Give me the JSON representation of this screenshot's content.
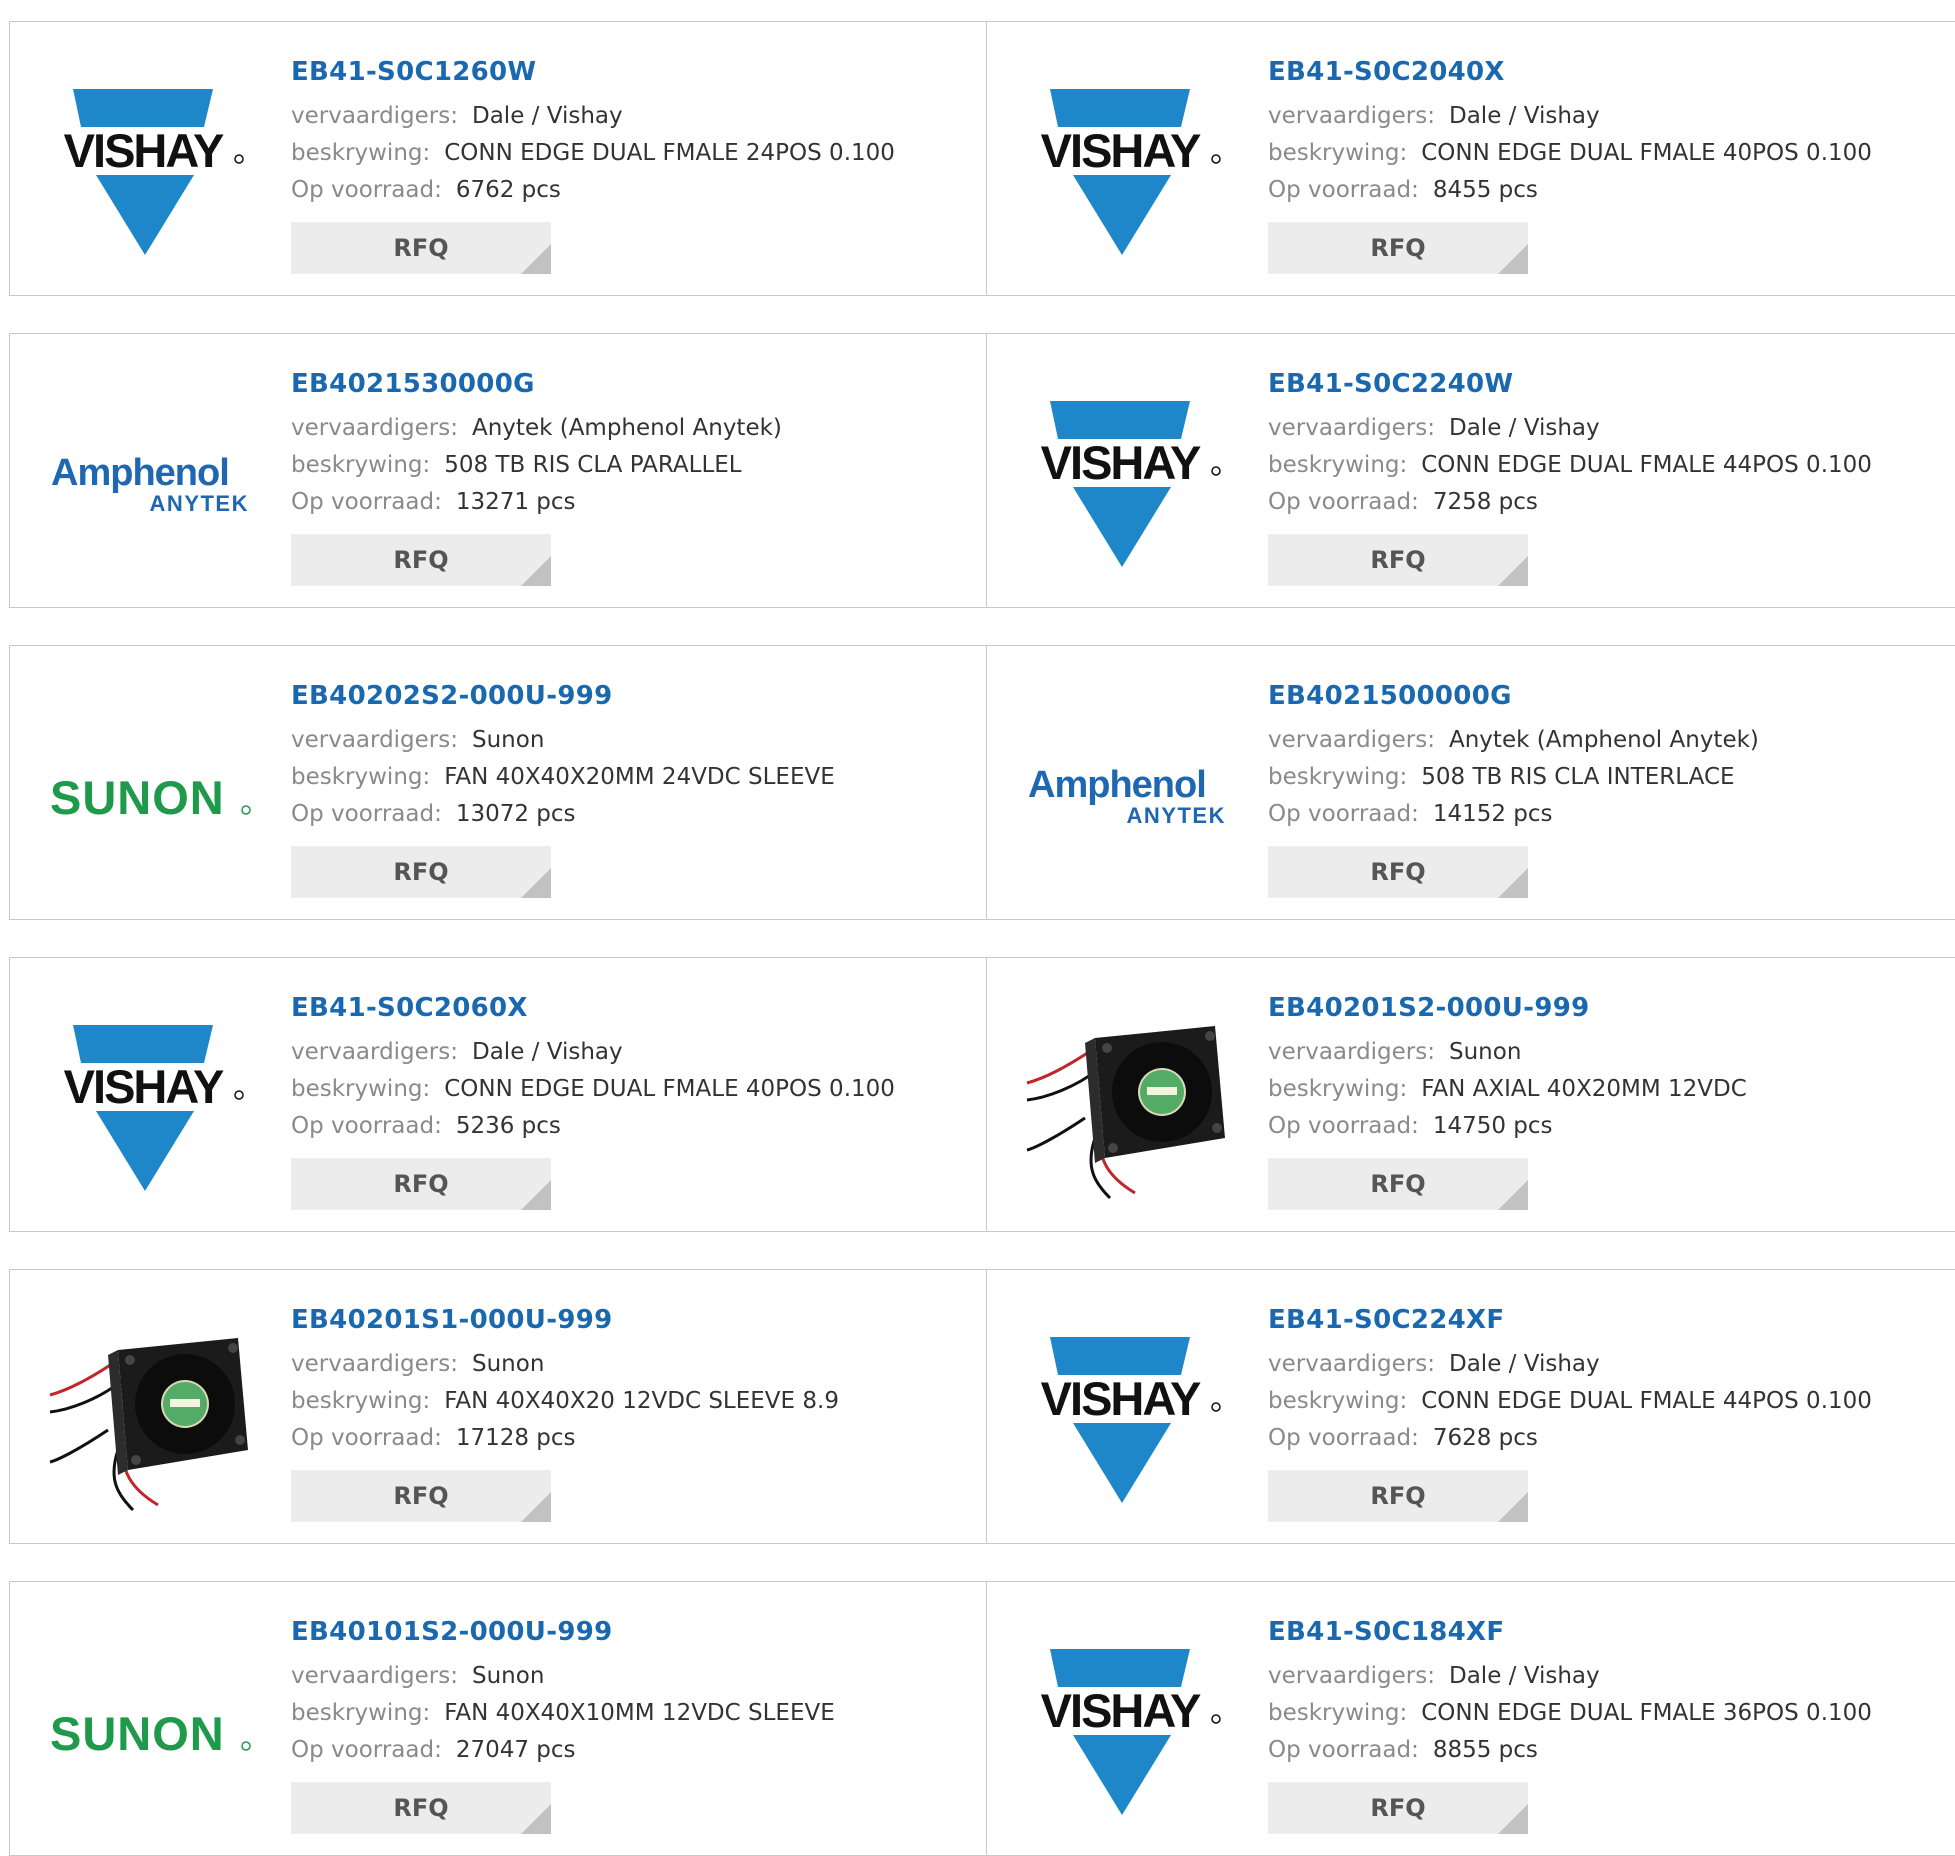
{
  "labels": {
    "manufacturer": "vervaardigers:",
    "description": "beskrywing:",
    "stock": "Op voorraad:",
    "rfq": "RFQ"
  },
  "products": [
    {
      "part": "EB41-S0C1260W",
      "logo": "vishay",
      "logo_text": "VISHAY",
      "manufacturer": "Dale / Vishay",
      "description": "CONN EDGE DUAL FMALE 24POS 0.100",
      "stock": "6762 pcs"
    },
    {
      "part": "EB41-S0C2040X",
      "logo": "vishay",
      "logo_text": "VISHAY",
      "manufacturer": "Dale / Vishay",
      "description": "CONN EDGE DUAL FMALE 40POS 0.100",
      "stock": "8455 pcs"
    },
    {
      "part": "EB4021530000G",
      "logo": "amphenol",
      "logo_text": "Amphenol",
      "logo_subtext": "ANYTEK",
      "manufacturer": "Anytek (Amphenol Anytek)",
      "description": "508 TB RIS CLA PARALLEL",
      "stock": "13271 pcs"
    },
    {
      "part": "EB41-S0C2240W",
      "logo": "vishay",
      "logo_text": "VISHAY",
      "manufacturer": "Dale / Vishay",
      "description": "CONN EDGE DUAL FMALE 44POS 0.100",
      "stock": "7258 pcs"
    },
    {
      "part": "EB40202S2-000U-999",
      "logo": "sunon",
      "logo_text": "SUNON",
      "manufacturer": "Sunon",
      "description": "FAN 40X40X20MM 24VDC SLEEVE",
      "stock": "13072 pcs"
    },
    {
      "part": "EB4021500000G",
      "logo": "amphenol",
      "logo_text": "Amphenol",
      "logo_subtext": "ANYTEK",
      "manufacturer": "Anytek (Amphenol Anytek)",
      "description": "508 TB RIS CLA INTERLACE",
      "stock": "14152 pcs"
    },
    {
      "part": "EB41-S0C2060X",
      "logo": "vishay",
      "logo_text": "VISHAY",
      "manufacturer": "Dale / Vishay",
      "description": "CONN EDGE DUAL FMALE 40POS 0.100",
      "stock": "5236 pcs"
    },
    {
      "part": "EB40201S2-000U-999",
      "logo": "fan",
      "manufacturer": "Sunon",
      "description": "FAN AXIAL 40X20MM 12VDC",
      "stock": "14750 pcs"
    },
    {
      "part": "EB40201S1-000U-999",
      "logo": "fan",
      "manufacturer": "Sunon",
      "description": "FAN 40X40X20 12VDC SLEEVE 8.9",
      "stock": "17128 pcs"
    },
    {
      "part": "EB41-S0C224XF",
      "logo": "vishay",
      "logo_text": "VISHAY",
      "manufacturer": "Dale / Vishay",
      "description": "CONN EDGE DUAL FMALE 44POS 0.100",
      "stock": "7628 pcs"
    },
    {
      "part": "EB40101S2-000U-999",
      "logo": "sunon",
      "logo_text": "SUNON",
      "manufacturer": "Sunon",
      "description": "FAN 40X40X10MM 12VDC SLEEVE",
      "stock": "27047 pcs"
    },
    {
      "part": "EB41-S0C184XF",
      "logo": "vishay",
      "logo_text": "VISHAY",
      "manufacturer": "Dale / Vishay",
      "description": "CONN EDGE DUAL FMALE 36POS 0.100",
      "stock": "8855 pcs"
    }
  ],
  "colors": {
    "part_link": "#1a68b0",
    "vishay_blue": "#1d87c9",
    "amphenol_blue": "#1f67b1",
    "sunon_green": "#1e9a4a"
  }
}
